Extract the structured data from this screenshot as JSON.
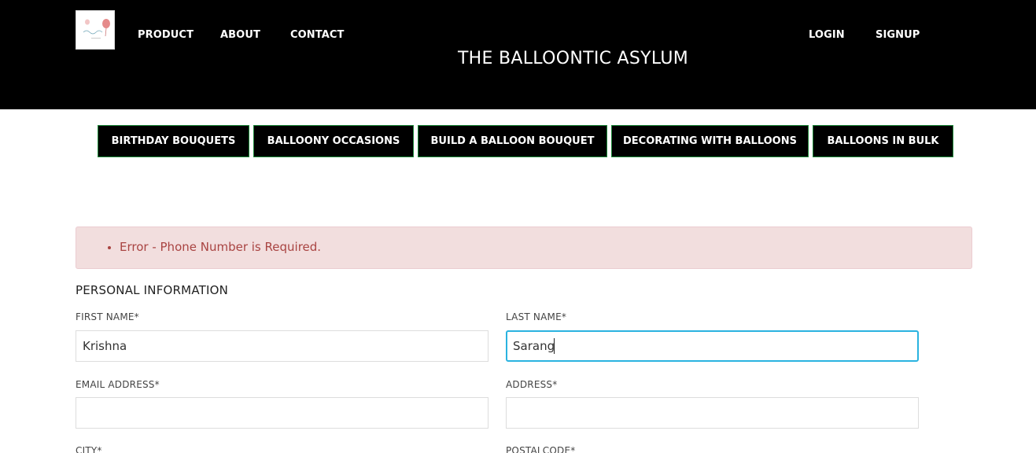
{
  "header": {
    "site_title": "THE BALLOONTIC ASYLUM",
    "logo_name": "balloon-logo",
    "nav_left": [
      "PRODUCT",
      "ABOUT",
      "CONTACT"
    ],
    "nav_right": [
      "LOGIN",
      "SIGNUP"
    ]
  },
  "categories": [
    "BIRTHDAY BOUQUETS",
    "BALLOONY OCCASIONS",
    "BUILD A BALLOON BOUQUET",
    "DECORATING WITH BALLOONS",
    "BALLOONS IN BULK"
  ],
  "alert": {
    "message": "Error - Phone Number is Required."
  },
  "form": {
    "section_title": "PERSONAL INFORMATION",
    "fields": {
      "first_name": {
        "label": "FIRST NAME*",
        "value": "Krishna"
      },
      "last_name": {
        "label": "LAST NAME*",
        "value": "Sarang"
      },
      "email": {
        "label": "EMAIL ADDRESS*",
        "value": ""
      },
      "address": {
        "label": "ADDRESS*",
        "value": ""
      },
      "city": {
        "label": "CITY*",
        "value": ""
      },
      "postalcode": {
        "label": "POSTALCODE*",
        "value": ""
      }
    }
  },
  "colors": {
    "header_bg": "#000000",
    "category_border": "#1d8a3a",
    "alert_bg": "#f2dede",
    "alert_text": "#a94442",
    "focus_border": "#2ab3e0"
  }
}
